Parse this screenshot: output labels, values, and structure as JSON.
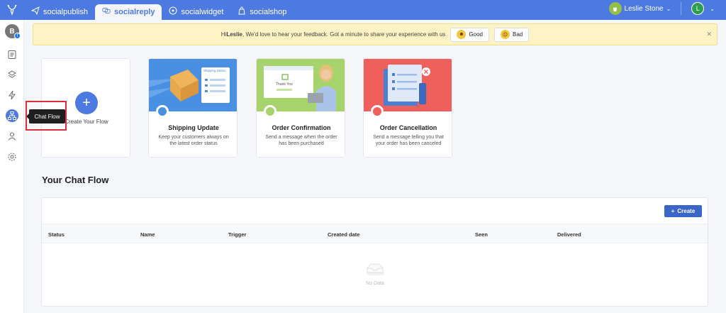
{
  "nav": {
    "tabs": [
      {
        "label": "socialpublish",
        "icon": "paper-plane-icon"
      },
      {
        "label": "socialreply",
        "icon": "chat-bubbles-icon"
      },
      {
        "label": "socialwidget",
        "icon": "widget-icon"
      },
      {
        "label": "socialshop",
        "icon": "shopping-bag-icon"
      }
    ],
    "active_tab": "socialreply",
    "user_name": "Leslie Stone",
    "user_initial": "L",
    "accent_color": "#4d7ae0"
  },
  "sidebar": {
    "account_initial": "B",
    "items": [
      "document-icon",
      "layers-icon",
      "lightning-icon",
      "chat-flow-icon",
      "person-icon",
      "gear-icon"
    ],
    "active_item": "chat-flow-icon",
    "tooltip": "Chat Flow"
  },
  "banner": {
    "greeting": "Hi ",
    "name": "Leslie",
    "message": ", We'd love to hear your feedback. Got a minute to share your experience with us",
    "good_label": "Good",
    "bad_label": "Bad"
  },
  "create_card": {
    "label": "Create Your Flow"
  },
  "templates": [
    {
      "title": "Shipping Update",
      "description": "Keep your customers always on the latest order status",
      "art_label": "Shipping Status",
      "color": "#4a90e2"
    },
    {
      "title": "Order Confirmation",
      "description": "Send a message when the order has been purchased",
      "art_label": "Thank You",
      "color": "#a6d36b"
    },
    {
      "title": "Order Cancellation",
      "description": "Send a message telling you that your order has been canceled",
      "art_label": "",
      "color": "#ef5f5b"
    }
  ],
  "chat_flow": {
    "title": "Your Chat Flow",
    "create_label": "Create",
    "columns": [
      "Status",
      "Name",
      "Trigger",
      "Created date",
      "Seen",
      "Delivered"
    ],
    "rows": [],
    "empty_label": "No Data"
  }
}
